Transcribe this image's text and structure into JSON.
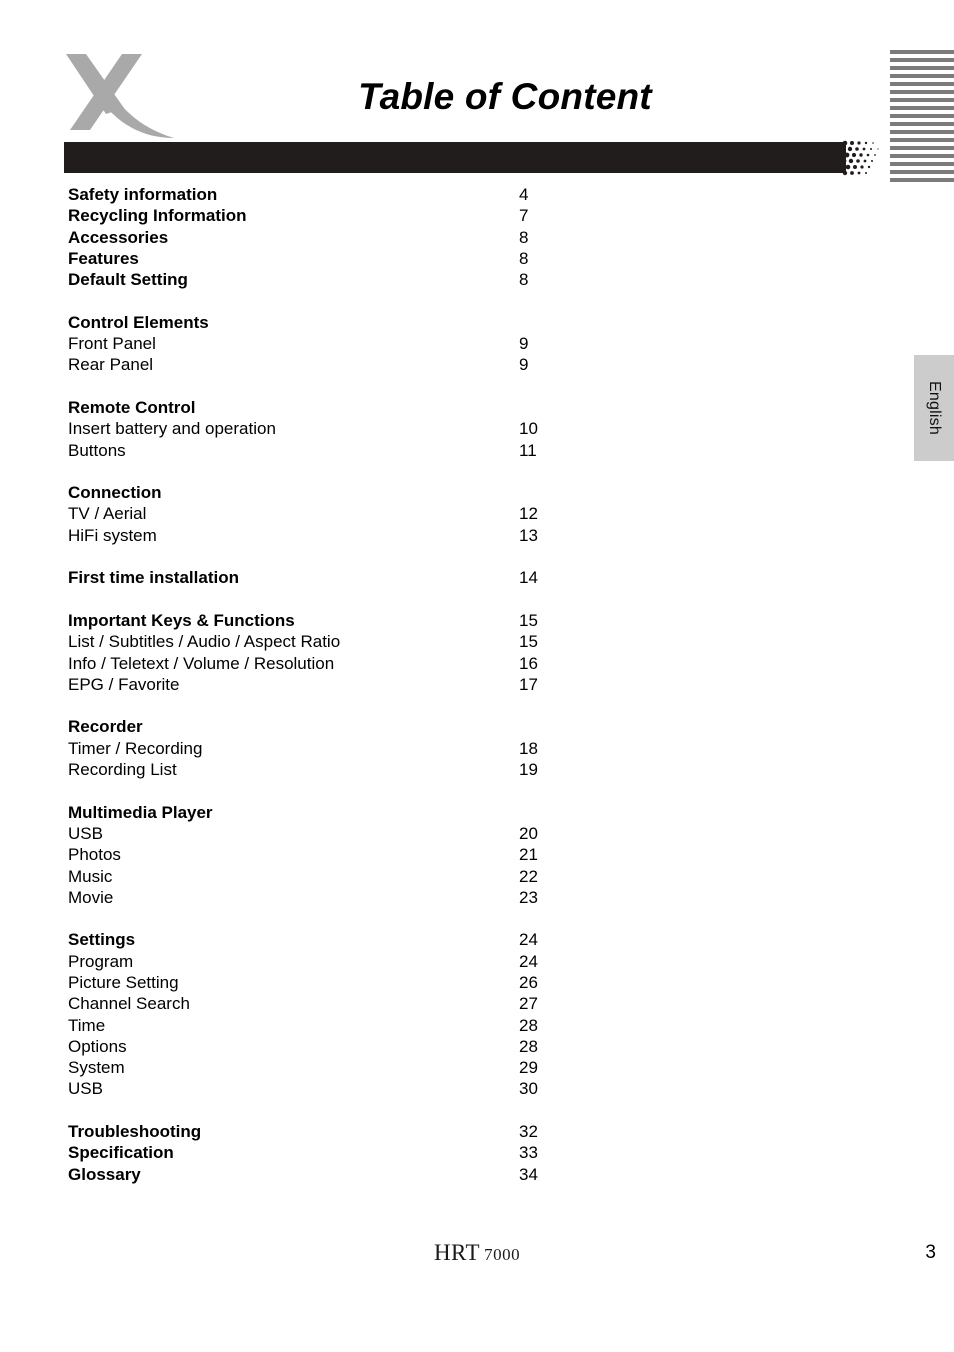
{
  "header": {
    "title": "Table of Content",
    "logo_icon": "xoro-x-logo-icon",
    "bar_color": "#211d1c",
    "stripe_color": "#7c7c7c"
  },
  "language_tab": {
    "label": "English",
    "background_color": "#cccccc"
  },
  "toc": {
    "entries": [
      {
        "label": "Safety information",
        "page": "4",
        "bold": true,
        "spacer_before": false
      },
      {
        "label": "Recycling Information",
        "page": "7",
        "bold": true,
        "spacer_before": false
      },
      {
        "label": "Accessories",
        "page": "8",
        "bold": true,
        "spacer_before": false
      },
      {
        "label": "Features",
        "page": "8",
        "bold": true,
        "spacer_before": false
      },
      {
        "label": "Default Setting",
        "page": "8",
        "bold": true,
        "spacer_before": false
      },
      {
        "label": "Control Elements",
        "page": "",
        "bold": true,
        "spacer_before": true
      },
      {
        "label": "Front Panel",
        "page": "9",
        "bold": false,
        "spacer_before": false
      },
      {
        "label": "Rear Panel",
        "page": "9",
        "bold": false,
        "spacer_before": false
      },
      {
        "label": "Remote Control",
        "page": "",
        "bold": true,
        "spacer_before": true
      },
      {
        "label": "Insert battery and operation",
        "page": "10",
        "bold": false,
        "spacer_before": false
      },
      {
        "label": "Buttons",
        "page": "11",
        "bold": false,
        "spacer_before": false
      },
      {
        "label": "Connection",
        "page": "",
        "bold": true,
        "spacer_before": true
      },
      {
        "label": "TV / Aerial",
        "page": "12",
        "bold": false,
        "spacer_before": false
      },
      {
        "label": "HiFi system",
        "page": "13",
        "bold": false,
        "spacer_before": false
      },
      {
        "label": "First time installation",
        "page": "14",
        "bold": true,
        "spacer_before": true
      },
      {
        "label": "Important Keys & Functions",
        "page": "15",
        "bold": true,
        "spacer_before": true
      },
      {
        "label": "List / Subtitles / Audio / Aspect Ratio",
        "page": "15",
        "bold": false,
        "spacer_before": false
      },
      {
        "label": "Info / Teletext / Volume / Resolution",
        "page": "16",
        "bold": false,
        "spacer_before": false
      },
      {
        "label": "EPG / Favorite",
        "page": "17",
        "bold": false,
        "spacer_before": false
      },
      {
        "label": "Recorder",
        "page": "",
        "bold": true,
        "spacer_before": true
      },
      {
        "label": "Timer / Recording",
        "page": "18",
        "bold": false,
        "spacer_before": false
      },
      {
        "label": "Recording List",
        "page": "19",
        "bold": false,
        "spacer_before": false
      },
      {
        "label": "Multimedia Player",
        "page": "",
        "bold": true,
        "spacer_before": true
      },
      {
        "label": "USB",
        "page": "20",
        "bold": false,
        "spacer_before": false
      },
      {
        "label": "Photos",
        "page": "21",
        "bold": false,
        "spacer_before": false
      },
      {
        "label": "Music",
        "page": "22",
        "bold": false,
        "spacer_before": false
      },
      {
        "label": "Movie",
        "page": "23",
        "bold": false,
        "spacer_before": false
      },
      {
        "label": "Settings",
        "page": "24",
        "bold": true,
        "spacer_before": true
      },
      {
        "label": "Program",
        "page": "24",
        "bold": false,
        "spacer_before": false
      },
      {
        "label": "Picture Setting",
        "page": "26",
        "bold": false,
        "spacer_before": false
      },
      {
        "label": "Channel Search",
        "page": "27",
        "bold": false,
        "spacer_before": false
      },
      {
        "label": "Time",
        "page": "28",
        "bold": false,
        "spacer_before": false
      },
      {
        "label": "Options",
        "page": "28",
        "bold": false,
        "spacer_before": false
      },
      {
        "label": "System",
        "page": "29",
        "bold": false,
        "spacer_before": false
      },
      {
        "label": "USB",
        "page": "30",
        "bold": false,
        "spacer_before": false
      },
      {
        "label": "Troubleshooting",
        "page": "32",
        "bold": true,
        "spacer_before": true
      },
      {
        "label": "Specification",
        "page": "33",
        "bold": true,
        "spacer_before": false
      },
      {
        "label": "Glossary",
        "page": "34",
        "bold": true,
        "spacer_before": false
      }
    ]
  },
  "footer": {
    "brand": "HRT",
    "model": "7000",
    "page_number": "3"
  }
}
